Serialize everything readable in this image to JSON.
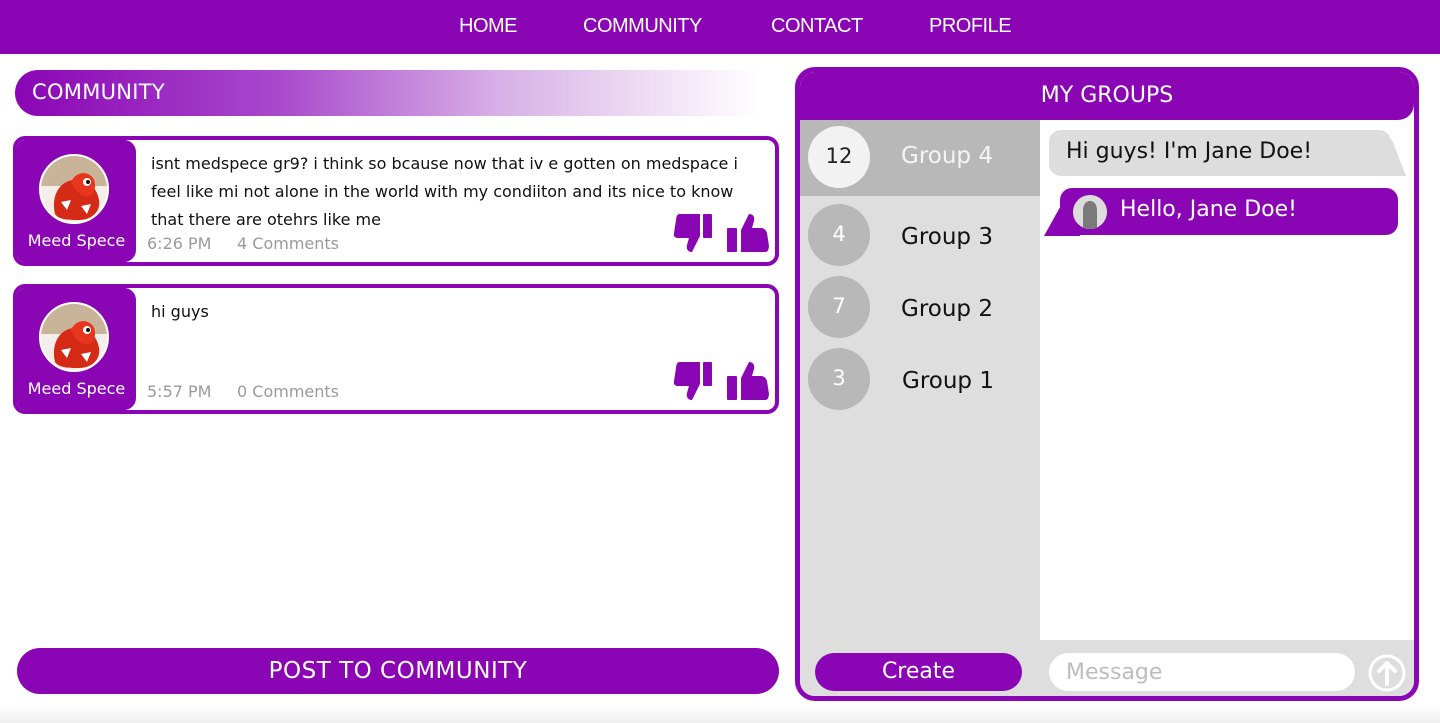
{
  "nav": {
    "items": [
      {
        "label": "HOME"
      },
      {
        "label": "COMMUNITY"
      },
      {
        "label": "CONTACT"
      },
      {
        "label": "PROFILE"
      }
    ]
  },
  "community": {
    "title": "COMMUNITY",
    "posts": [
      {
        "author": "Meed Spece",
        "text": "isnt medspece gr9? i think so bcause now that iv e gotten on medspace i feel like mi not alone in the world with my condiiton and its nice to know that there are otehrs like me",
        "time": "6:26 PM",
        "comments": "4 Comments"
      },
      {
        "author": "Meed Spece",
        "text": "hi guys",
        "time": "5:57 PM",
        "comments": "0 Comments"
      }
    ],
    "post_button": "POST TO COMMUNITY"
  },
  "groups": {
    "title": "MY GROUPS",
    "list": [
      {
        "count": "12",
        "name": "Group 4",
        "active": true
      },
      {
        "count": "4",
        "name": "Group 3",
        "active": false
      },
      {
        "count": "7",
        "name": "Group 2",
        "active": false
      },
      {
        "count": "3",
        "name": "Group 1",
        "active": false
      }
    ],
    "messages": [
      {
        "text": "Hi guys! I'm Jane Doe!",
        "direction": "incoming"
      },
      {
        "text": "Hello, Jane Doe!",
        "direction": "outgoing"
      }
    ],
    "create_button": "Create",
    "message_placeholder": "Message"
  },
  "icons": {
    "thumbs_down": "thumbs-down-icon",
    "thumbs_up": "thumbs-up-icon",
    "send": "arrow-up-circle-icon",
    "avatar": "red-creature-avatar",
    "user": "user-silhouette-icon"
  },
  "colors": {
    "brand": "#8a05b4",
    "panel_gray": "#dedede",
    "active_gray": "#b8b8b8",
    "muted_text": "#9a9a9a"
  }
}
